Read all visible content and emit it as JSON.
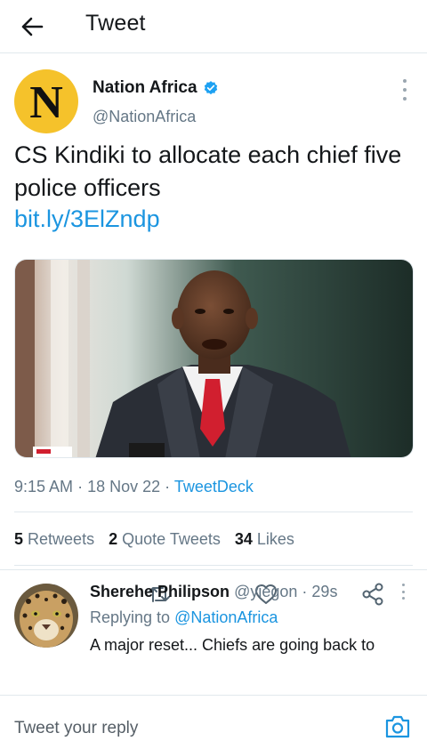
{
  "header": {
    "title": "Tweet",
    "back_icon": "arrow-left-icon"
  },
  "tweet": {
    "avatar_letter": "N",
    "author_name": "Nation Africa",
    "author_handle": "@NationAfrica",
    "text": "CS Kindiki to allocate each chief five police officers",
    "link": "bit.ly/3ElZndp",
    "time": "9:15 AM",
    "date": "18 Nov 22",
    "source": "TweetDeck",
    "separator": "·",
    "stats": {
      "retweets_count": "5",
      "retweets_label": "Retweets",
      "quote_count": "2",
      "quote_label": "Quote Tweets",
      "likes_count": "34",
      "likes_label": "Likes"
    },
    "colors": {
      "avatar_bg": "#f5c22b",
      "link": "#1b95e0",
      "verified": "#1da1f2"
    }
  },
  "reply": {
    "author_name": "Sherehe Philipson",
    "author_handle": "@yiegon",
    "time": "29s",
    "separator": "·",
    "replying_prefix": "Replying to",
    "replying_mention": "@NationAfrica",
    "text": "A major reset... Chiefs are going back to"
  },
  "composer": {
    "placeholder": "Tweet your reply"
  }
}
